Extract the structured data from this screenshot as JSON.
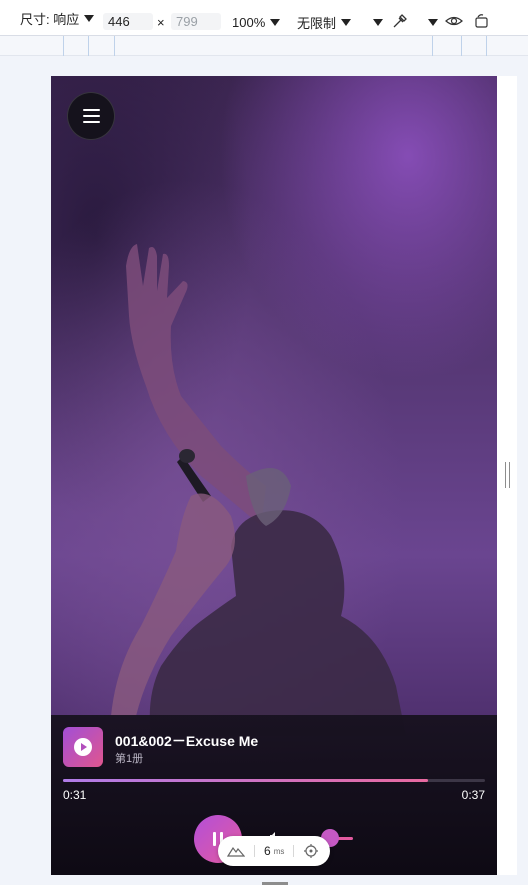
{
  "toolbar": {
    "size_label": "尺寸: 响应",
    "width_value": "446",
    "times": "×",
    "height_placeholder": "799",
    "zoom": "100%",
    "throttle": "无限制"
  },
  "player": {
    "title": "001&002－Excuse Me",
    "subtitle": "第1册",
    "current_time": "0:31",
    "duration": "0:37",
    "progress": 0.865
  },
  "perf_badge": {
    "value": "6",
    "unit": "ms"
  },
  "colors": {
    "accent_start": "#b34fd8",
    "accent_end": "#e35aa0"
  }
}
